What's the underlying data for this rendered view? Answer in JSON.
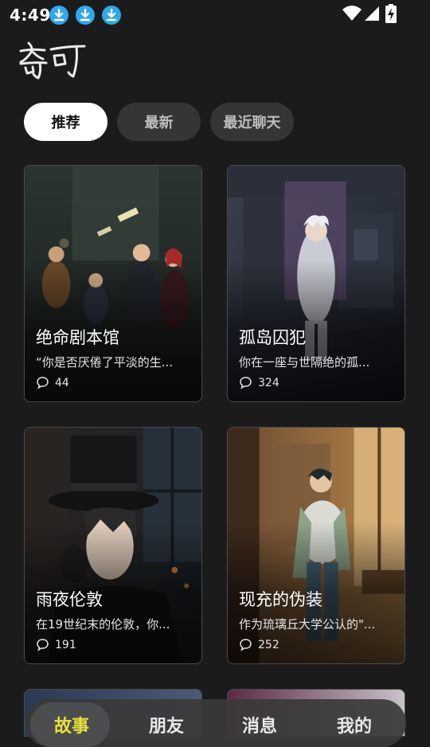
{
  "status": {
    "time": "4:49"
  },
  "tabs": [
    {
      "label": "推荐",
      "active": true
    },
    {
      "label": "最新",
      "active": false
    },
    {
      "label": "最近聊天",
      "active": false
    }
  ],
  "cards": [
    {
      "title": "绝命剧本馆",
      "desc": "“你是否厌倦了平淡的生...",
      "comments": "44"
    },
    {
      "title": "孤岛囚犯",
      "desc": "你在一座与世隔绝的孤...",
      "comments": "324"
    },
    {
      "title": "雨夜伦敦",
      "desc": "在19世纪末的伦敦，你...",
      "comments": "191"
    },
    {
      "title": "现充的伪装",
      "desc": "作为琉璃丘大学公认的\"...",
      "comments": "252"
    }
  ],
  "nav": [
    {
      "label": "故事",
      "active": true
    },
    {
      "label": "朋友",
      "active": false
    },
    {
      "label": "消息",
      "active": false
    },
    {
      "label": "我的",
      "active": false
    }
  ],
  "colors": {
    "accent": "#e6e23c",
    "download_badge": "#2ea8ee",
    "background": "#1b1b1b"
  }
}
